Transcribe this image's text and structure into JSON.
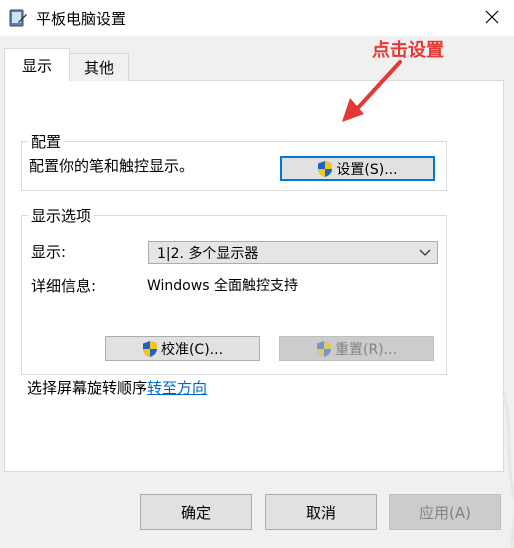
{
  "window": {
    "title": "平板电脑设置"
  },
  "tabs": [
    {
      "label": "显示",
      "active": true
    },
    {
      "label": "其他",
      "active": false
    }
  ],
  "config_group": {
    "legend": "配置",
    "description": "配置你的笔和触控显示。",
    "setup_button": "设置(S)..."
  },
  "display_group": {
    "legend": "显示选项",
    "display_label": "显示:",
    "display_select_value": "1|2. 多个显示器",
    "details_label": "详细信息:",
    "details_value": "Windows 全面触控支持",
    "calibrate_button": "校准(C)...",
    "reset_button": "重置(R)..."
  },
  "rotation": {
    "text": "选择屏幕旋转顺序",
    "link": "转至方向"
  },
  "footer": {
    "ok": "确定",
    "cancel": "取消",
    "apply": "应用(A)"
  },
  "annotation": {
    "text": "点击设置",
    "color": "#e53935"
  },
  "colors": {
    "focus": "#0078d7",
    "link": "#0066cc",
    "shield_blue": "#1e63c4",
    "shield_yellow": "#f5c518"
  },
  "icons": [
    "tablet-settings-icon",
    "close-icon",
    "uac-shield-icon",
    "chevron-down-icon"
  ]
}
